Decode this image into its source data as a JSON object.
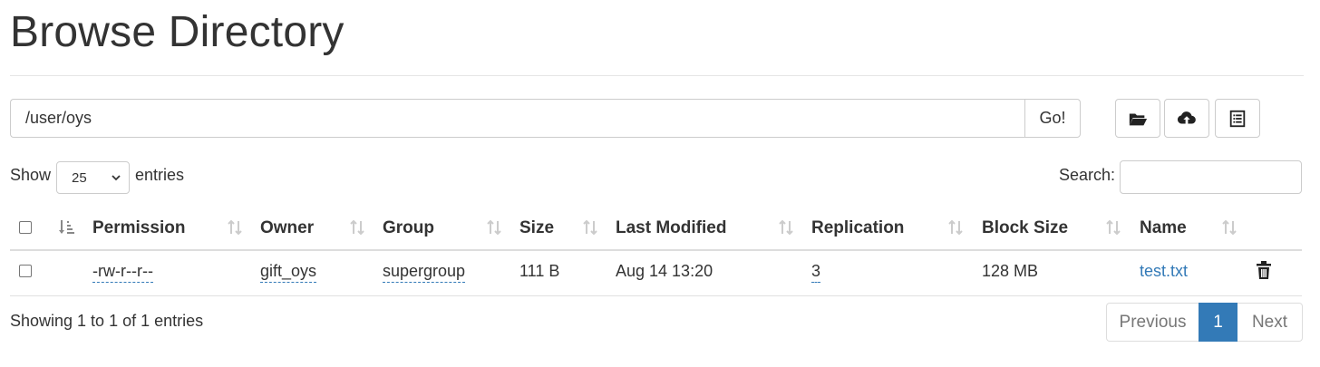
{
  "header": {
    "title": "Browse Directory"
  },
  "path_bar": {
    "value": "/user/oys",
    "go_label": "Go!"
  },
  "toolbar": {
    "icons": [
      "folder-open-icon",
      "cloud-upload-icon",
      "list-icon"
    ]
  },
  "length_menu": {
    "show_label": "Show",
    "selected": "25",
    "entries_label": "entries"
  },
  "search": {
    "label": "Search:",
    "value": ""
  },
  "table": {
    "columns": [
      "Permission",
      "Owner",
      "Group",
      "Size",
      "Last Modified",
      "Replication",
      "Block Size",
      "Name"
    ],
    "rows": [
      {
        "permission": "-rw-r--r--",
        "owner": "gift_oys",
        "group": "supergroup",
        "size": "111 B",
        "last_modified": "Aug 14 13:20",
        "replication": "3",
        "block_size": "128 MB",
        "name": "test.txt"
      }
    ]
  },
  "footer": {
    "info": "Showing 1 to 1 of 1 entries"
  },
  "pagination": {
    "previous": "Previous",
    "current": "1",
    "next": "Next"
  },
  "colors": {
    "link": "#337ab7",
    "active_page": "#337ab7",
    "border": "#cccccc"
  }
}
